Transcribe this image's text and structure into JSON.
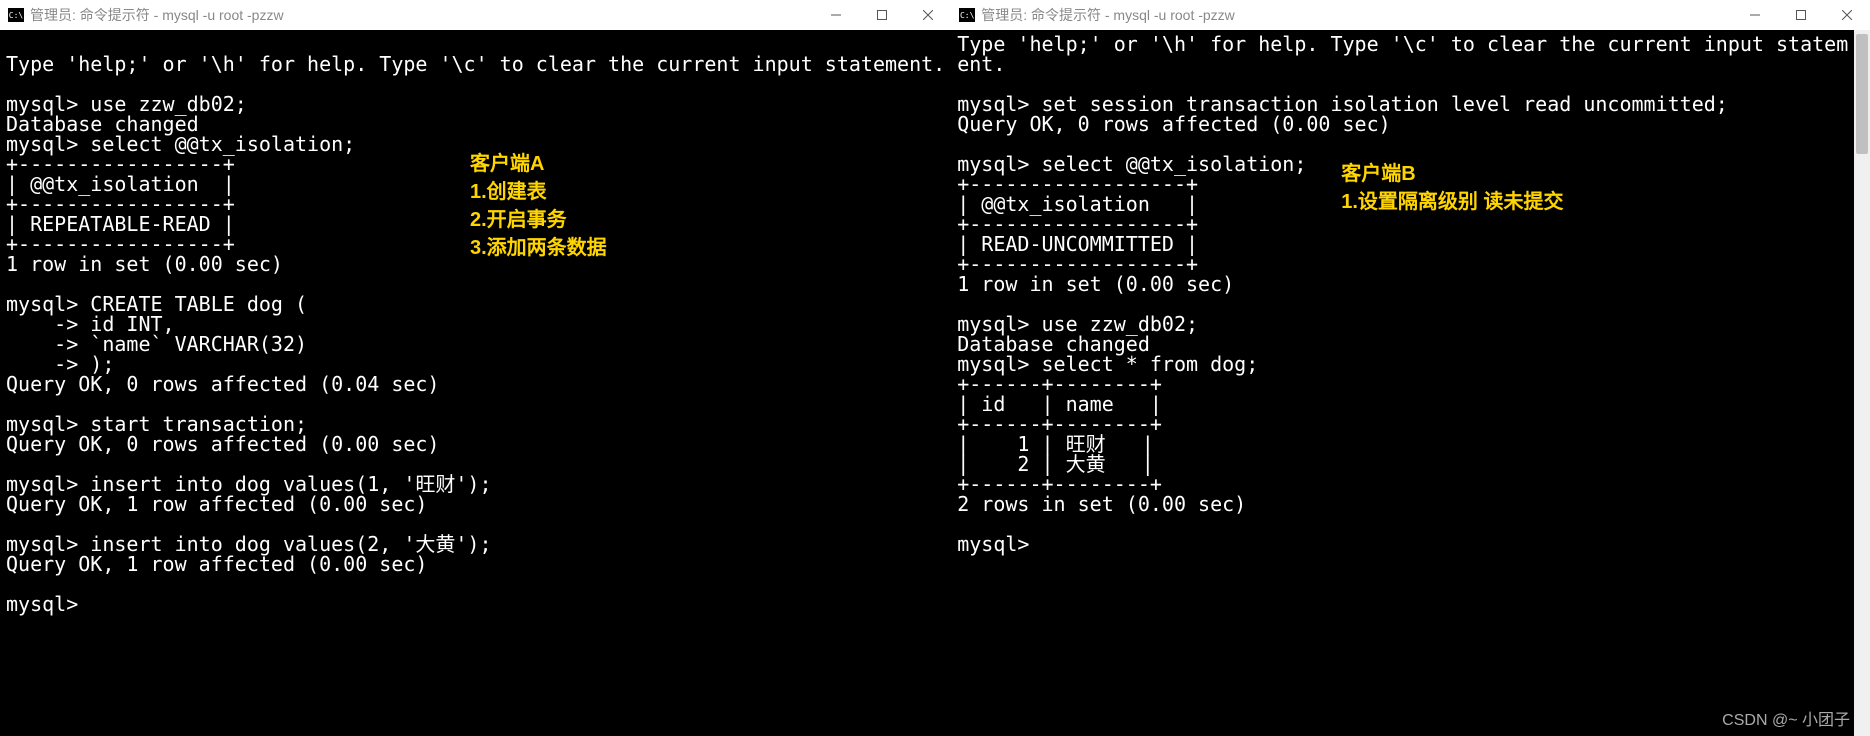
{
  "windowA": {
    "title": "管理员: 命令提示符 - mysql  -u root -pzzw",
    "icon_text": "C:\\",
    "terminal_lines": [
      "",
      "Type 'help;' or '\\h' for help. Type '\\c' to clear the current input statement.",
      "",
      "mysql> use zzw_db02;",
      "Database changed",
      "mysql> select @@tx_isolation;",
      "+-----------------+",
      "| @@tx_isolation  |",
      "+-----------------+",
      "| REPEATABLE-READ |",
      "+-----------------+",
      "1 row in set (0.00 sec)",
      "",
      "mysql> CREATE TABLE dog (",
      "    -> id INT,",
      "    -> `name` VARCHAR(32)",
      "    -> );",
      "Query OK, 0 rows affected (0.04 sec)",
      "",
      "mysql> start transaction;",
      "Query OK, 0 rows affected (0.00 sec)",
      "",
      "mysql> insert into dog values(1, '旺财');",
      "Query OK, 1 row affected (0.00 sec)",
      "",
      "mysql> insert into dog values(2, '大黄');",
      "Query OK, 1 row affected (0.00 sec)",
      "",
      "mysql>"
    ],
    "annotation": "客户端A\n1.创建表\n2.开启事务\n3.添加两条数据"
  },
  "windowB": {
    "title": "管理员: 命令提示符 - mysql  -u root -pzzw",
    "icon_text": "C:\\",
    "terminal_lines": [
      "Type 'help;' or '\\h' for help. Type '\\c' to clear the current input statem",
      "ent.",
      "",
      "mysql> set session transaction isolation level read uncommitted;",
      "Query OK, 0 rows affected (0.00 sec)",
      "",
      "mysql> select @@tx_isolation;",
      "+------------------+",
      "| @@tx_isolation   |",
      "+------------------+",
      "| READ-UNCOMMITTED |",
      "+------------------+",
      "1 row in set (0.00 sec)",
      "",
      "mysql> use zzw_db02;",
      "Database changed",
      "mysql> select * from dog;",
      "+------+--------+",
      "| id   | name   |",
      "+------+--------+",
      "|    1 | 旺财   |",
      "|    2 | 大黄   |",
      "+------+--------+",
      "2 rows in set (0.00 sec)",
      "",
      "mysql>"
    ],
    "annotation": "客户端B\n1.设置隔离级别 读未提交"
  },
  "watermark": "CSDN @~ 小团子"
}
